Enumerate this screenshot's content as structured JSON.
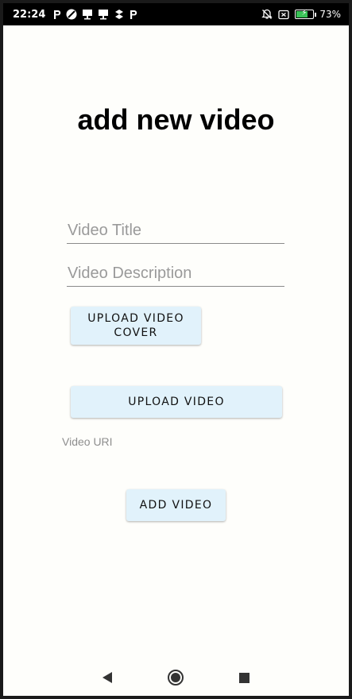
{
  "status_bar": {
    "time": "22:24",
    "notification_icons": [
      "p-icon",
      "circle-slash-icon",
      "monitor-icon",
      "monitor-icon",
      "dropbox-icon",
      "p-icon"
    ],
    "battery_percent": "73%",
    "battery_level": 0.73
  },
  "screen": {
    "title": "add new video",
    "video_title_placeholder": "Video Title",
    "video_title_value": "",
    "video_description_placeholder": "Video Description",
    "video_description_value": "",
    "upload_cover_label": "UPLOAD VIDEO COVER",
    "upload_video_label": "UPLOAD VIDEO",
    "video_uri_label": "Video URI",
    "add_video_label": "ADD VIDEO"
  },
  "colors": {
    "background": "#fefefb",
    "button_bg": "#e1f2fb",
    "status_bar": "#000000",
    "battery_fill": "#39c257"
  }
}
